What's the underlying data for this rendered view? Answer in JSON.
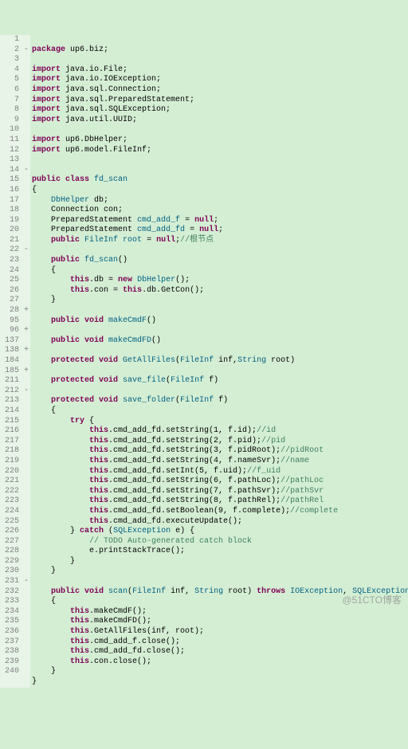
{
  "watermark": "@51CTO博客",
  "gutter_lines": [
    "1",
    "2",
    "3",
    "4",
    "5",
    "6",
    "7",
    "8",
    "9",
    "10",
    "11",
    "12",
    "13",
    "14",
    "15",
    "16",
    "17",
    "18",
    "19",
    "20",
    "21",
    "22",
    "23",
    "24",
    "25",
    "26",
    "27",
    "28",
    "95",
    "96",
    "137",
    "138",
    "184",
    "185",
    "211",
    "212",
    "213",
    "214",
    "215",
    "216",
    "217",
    "218",
    "219",
    "220",
    "221",
    "222",
    "223",
    "224",
    "225",
    "226",
    "227",
    "228",
    "229",
    "230",
    "231",
    "232",
    "233",
    "234",
    "235",
    "236",
    "237",
    "238",
    "239",
    "240"
  ],
  "fold_marks": [
    "",
    "-",
    "",
    "",
    "",
    "",
    "",
    "",
    "",
    "",
    "",
    "",
    "",
    "-",
    "",
    "",
    "",
    "",
    "",
    "",
    "",
    "-",
    "",
    "",
    "",
    "",
    "",
    "+",
    "",
    "+",
    "",
    "+",
    "",
    "+",
    "",
    "-",
    "",
    "",
    "",
    "",
    "",
    "",
    "",
    "",
    "",
    "",
    "",
    "",
    "",
    "",
    "",
    "",
    "",
    "",
    "-",
    "",
    "",
    "",
    "",
    "",
    "",
    "",
    "",
    "",
    ""
  ],
  "code": {
    "l1": {
      "t": "package ",
      "pkg": "up6.biz",
      ";": ";"
    },
    "l2": "",
    "l3": {
      "t": "import ",
      "pkg": "java.io.File",
      ";": ";"
    },
    "l4": {
      "t": "import ",
      "pkg": "java.io.IOException",
      ";": ";"
    },
    "l5": {
      "t": "import ",
      "pkg": "java.sql.Connection",
      ";": ";"
    },
    "l6": {
      "t": "import ",
      "pkg": "java.sql.PreparedStatement",
      ";": ";"
    },
    "l7": {
      "t": "import ",
      "pkg": "java.sql.SQLException",
      ";": ";"
    },
    "l8": {
      "t": "import ",
      "pkg": "java.util.UUID",
      ";": ";"
    },
    "l9": "",
    "l10": {
      "t": "import ",
      "pkg": "up6.DbHelper",
      ";": ";"
    },
    "l11": {
      "t": "import ",
      "pkg": "up6.model.FileInf",
      ";": ";"
    },
    "l12": "",
    "l13": "",
    "l14": {
      "p1": "public class ",
      "name": "fd_scan"
    },
    "l15": "{",
    "l16": {
      "ind": "    ",
      "typ": "DbHelper",
      "rest": " db;"
    },
    "l17": {
      "ind": "    ",
      "txt": "Connection con;"
    },
    "l18": {
      "ind": "    ",
      "p1": "PreparedStatement ",
      "var": "cmd_add_f",
      "p2": " = ",
      "kw": "null",
      "p3": ";"
    },
    "l19": {
      "ind": "    ",
      "p1": "PreparedStatement ",
      "var": "cmd_add_fd",
      "p2": " = ",
      "kw": "null",
      "p3": ";"
    },
    "l20": {
      "ind": "    ",
      "kw1": "public ",
      "typ": "FileInf ",
      "var": "root",
      "p1": " = ",
      "kw2": "null",
      "p2": ";",
      "cmt": "//根节点"
    },
    "l21": "",
    "l22": {
      "ind": "    ",
      "kw": "public ",
      "name": "fd_scan",
      "p": "()"
    },
    "l23": "    {",
    "l24": {
      "ind": "        ",
      "kw1": "this",
      "p1": ".db = ",
      "kw2": "new ",
      "typ": "DbHelper",
      "p2": "();"
    },
    "l25": {
      "ind": "        ",
      "kw1": "this",
      "p1": ".con = ",
      "kw2": "this",
      "p2": ".db.GetCon();"
    },
    "l26": "    }",
    "l27": "",
    "l28": {
      "ind": "    ",
      "kw": "public void ",
      "name": "makeCmdF",
      "p": "()"
    },
    "l95": "",
    "l96": {
      "ind": "    ",
      "kw": "public void ",
      "name": "makeCmdFD",
      "p": "()"
    },
    "l137": "",
    "l138": {
      "ind": "    ",
      "kw": "protected void ",
      "name": "GetAllFiles",
      "p1": "(",
      "typ1": "FileInf",
      "p2": " inf,",
      "typ2": "String",
      "p3": " root)"
    },
    "l184": "",
    "l185": {
      "ind": "    ",
      "kw": "protected void ",
      "name": "save_file",
      "p1": "(",
      "typ": "FileInf",
      "p2": " f)"
    },
    "l211": "",
    "l212": {
      "ind": "    ",
      "kw": "protected void ",
      "name": "save_folder",
      "p1": "(",
      "typ": "FileInf",
      "p2": " f)"
    },
    "l213": "    {",
    "l214": {
      "ind": "        ",
      "kw": "try",
      " p": " {"
    },
    "l215": {
      "ind": "            ",
      "kw": "this",
      "p1": ".cmd_add_fd.setString(1, f.id);",
      "cmt": "//id"
    },
    "l216": {
      "ind": "            ",
      "kw": "this",
      "p1": ".cmd_add_fd.setString(2, f.pid);",
      "cmt": "//pid"
    },
    "l217": {
      "ind": "            ",
      "kw": "this",
      "p1": ".cmd_add_fd.setString(3, f.pidRoot);",
      "cmt": "//pidRoot"
    },
    "l218": {
      "ind": "            ",
      "kw": "this",
      "p1": ".cmd_add_fd.setString(4, f.nameSvr);",
      "cmt": "//name"
    },
    "l219": {
      "ind": "            ",
      "kw": "this",
      "p1": ".cmd_add_fd.setInt(5, f.uid);",
      "cmt": "//f_uid"
    },
    "l220": {
      "ind": "            ",
      "kw": "this",
      "p1": ".cmd_add_fd.setString(6, f.pathLoc);",
      "cmt": "//pathLoc"
    },
    "l221": {
      "ind": "            ",
      "kw": "this",
      "p1": ".cmd_add_fd.setString(7, f.pathSvr);",
      "cmt": "//pathSvr"
    },
    "l222": {
      "ind": "            ",
      "kw": "this",
      "p1": ".cmd_add_fd.setString(8, f.pathRel);",
      "cmt": "//pathRel"
    },
    "l223": {
      "ind": "            ",
      "kw": "this",
      "p1": ".cmd_add_fd.setBoolean(9, f.complete);",
      "cmt": "//complete"
    },
    "l224": {
      "ind": "            ",
      "kw": "this",
      "p1": ".cmd_add_fd.executeUpdate();"
    },
    "l225": {
      "ind": "        ",
      "p1": "} ",
      "kw": "catch",
      "p2": " (",
      "typ": "SQLException",
      "p3": " e) {"
    },
    "l226": {
      "ind": "            ",
      "cmt": "// TODO Auto-generated catch block"
    },
    "l227": {
      "ind": "            ",
      "txt": "e.printStackTrace();"
    },
    "l228": "        }",
    "l229": "    }",
    "l230": "",
    "l231": {
      "ind": "    ",
      "kw1": "public void ",
      "name": "scan",
      "p1": "(",
      "typ1": "FileInf",
      "p2": " inf, ",
      "typ2": "String",
      "p3": " root) ",
      "kw2": "throws ",
      "typ3": "IOException",
      "p4": ", ",
      "typ4": "SQLException"
    },
    "l232": "    {",
    "l233": {
      "ind": "        ",
      "kw": "this",
      "p": ".makeCmdF();"
    },
    "l234": {
      "ind": "        ",
      "kw": "this",
      "p": ".makeCmdFD();"
    },
    "l235": {
      "ind": "        ",
      "kw": "this",
      "p": ".GetAllFiles(inf, root);"
    },
    "l236": {
      "ind": "        ",
      "kw": "this",
      "p": ".cmd_add_f.close();"
    },
    "l237": {
      "ind": "        ",
      "kw": "this",
      "p": ".cmd_add_fd.close();"
    },
    "l238": {
      "ind": "        ",
      "kw": "this",
      "p": ".con.close();"
    },
    "l239": "    }",
    "l240": "}"
  }
}
